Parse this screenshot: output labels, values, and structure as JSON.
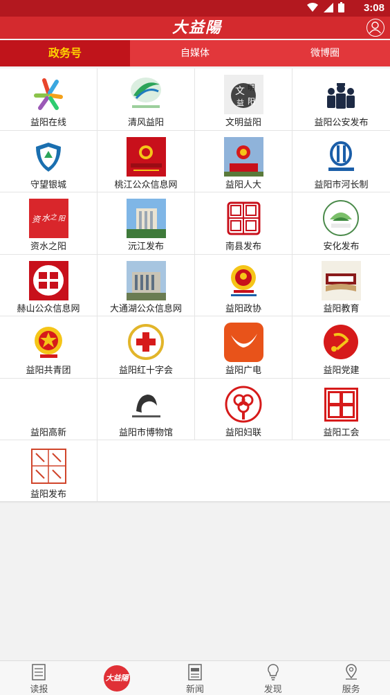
{
  "status_bar": {
    "time": "3:08",
    "icons": [
      "wifi-icon",
      "signal-icon",
      "battery-icon"
    ]
  },
  "app_bar": {
    "logo_text": "大益陽"
  },
  "tabs": [
    {
      "label": "政务号",
      "active": true
    },
    {
      "label": "自媒体",
      "active": false
    },
    {
      "label": "微博圈",
      "active": false
    }
  ],
  "accounts": [
    {
      "label": "益阳在线",
      "icon": "yiyang-online-icon"
    },
    {
      "label": "清风益阳",
      "icon": "qingfeng-yiyang-icon"
    },
    {
      "label": "文明益阳",
      "icon": "wenming-yiyang-icon"
    },
    {
      "label": "益阳公安发布",
      "icon": "police-icon"
    },
    {
      "label": "守望银城",
      "icon": "shield-icon"
    },
    {
      "label": "桃江公众信息网",
      "icon": "taojiang-icon"
    },
    {
      "label": "益阳人大",
      "icon": "renda-icon"
    },
    {
      "label": "益阳市河长制",
      "icon": "river-chief-icon"
    },
    {
      "label": "资水之阳",
      "icon": "zishui-icon"
    },
    {
      "label": "沅江发布",
      "icon": "yuanjiang-icon"
    },
    {
      "label": "南县发布",
      "icon": "nanxian-seal-icon"
    },
    {
      "label": "安化发布",
      "icon": "anhua-icon"
    },
    {
      "label": "赫山公众信息网",
      "icon": "heshan-icon"
    },
    {
      "label": "大通湖公众信息网",
      "icon": "datonghu-icon"
    },
    {
      "label": "益阳政协",
      "icon": "zhengxie-icon"
    },
    {
      "label": "益阳教育",
      "icon": "education-icon"
    },
    {
      "label": "益阳共青团",
      "icon": "youth-league-icon"
    },
    {
      "label": "益阳红十字会",
      "icon": "red-cross-icon"
    },
    {
      "label": "益阳广电",
      "icon": "guangdian-icon"
    },
    {
      "label": "益阳党建",
      "icon": "party-icon"
    },
    {
      "label": "益阳高新",
      "icon": "gaoxin-icon"
    },
    {
      "label": "益阳市博物馆",
      "icon": "museum-icon"
    },
    {
      "label": "益阳妇联",
      "icon": "women-federation-icon"
    },
    {
      "label": "益阳工会",
      "icon": "trade-union-icon"
    },
    {
      "label": "益阳发布",
      "icon": "yiyang-release-icon"
    }
  ],
  "bottom_nav": [
    {
      "label": "读报",
      "icon": "newspaper-icon"
    },
    {
      "label": "",
      "icon": "app-logo-icon",
      "logo_text": "大益陽"
    },
    {
      "label": "新闻",
      "icon": "news-icon"
    },
    {
      "label": "发现",
      "icon": "lightbulb-icon"
    },
    {
      "label": "服务",
      "icon": "location-pin-icon"
    }
  ],
  "colors": {
    "primary": "#d42a2e",
    "status_bar": "#b3181f",
    "active_tab": "#c0141b",
    "active_tab_text": "#ffd400"
  }
}
